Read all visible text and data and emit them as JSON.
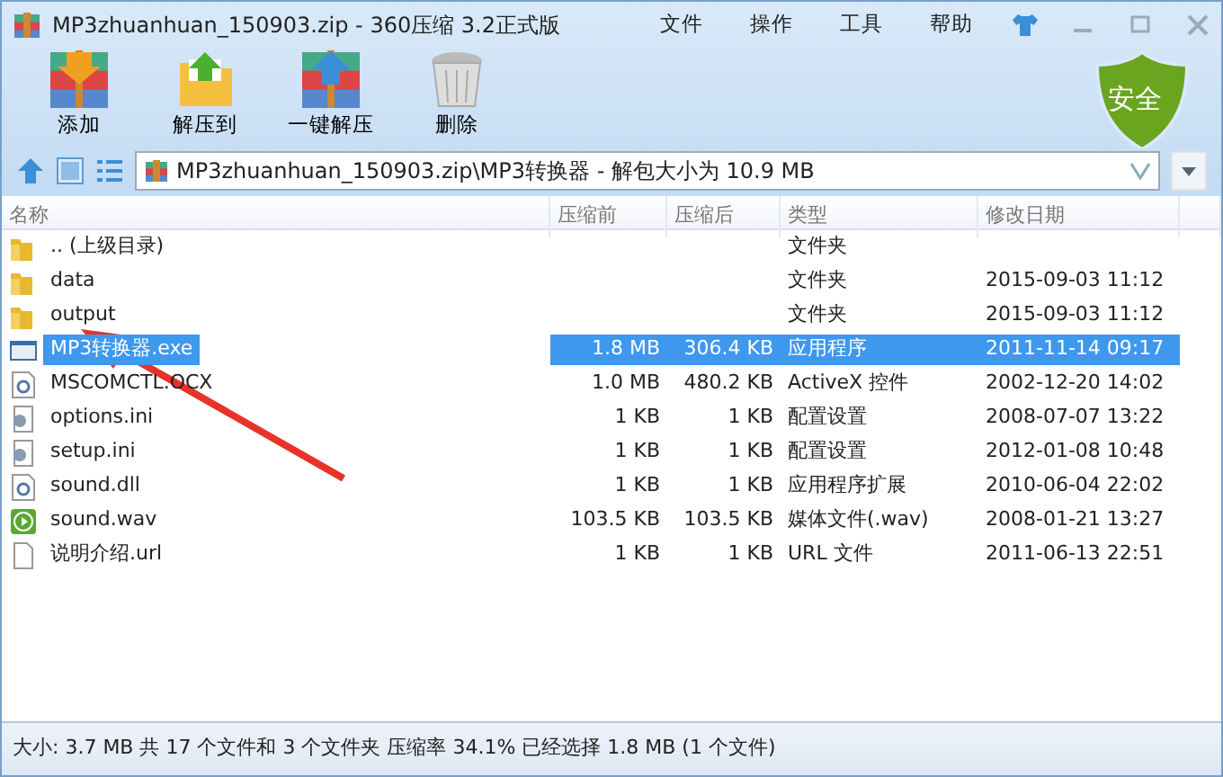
{
  "window": {
    "title": "MP3zhuanhuan_150903.zip - 360压缩 3.2正式版"
  },
  "menu": [
    "文件",
    "操作",
    "工具",
    "帮助"
  ],
  "toolbar": [
    {
      "label": "添加",
      "kind": "add"
    },
    {
      "label": "解压到",
      "kind": "extract-to"
    },
    {
      "label": "一键解压",
      "kind": "extract"
    },
    {
      "label": "删除",
      "kind": "delete"
    }
  ],
  "security_badge": "安全",
  "address": {
    "value": "MP3zhuanhuan_150903.zip\\MP3转换器 - 解包大小为 10.9 MB"
  },
  "table": {
    "columns": [
      "名称",
      "压缩前",
      "压缩后",
      "类型",
      "修改日期"
    ],
    "rows": [
      {
        "kind": "folder",
        "name": ".. (上级目录)",
        "size": "",
        "packed": "",
        "type": "文件夹",
        "modified": "",
        "selected": false
      },
      {
        "kind": "folder",
        "name": "data",
        "size": "",
        "packed": "",
        "type": "文件夹",
        "modified": "2015-09-03 11:12",
        "selected": false
      },
      {
        "kind": "folder",
        "name": "output",
        "size": "",
        "packed": "",
        "type": "文件夹",
        "modified": "2015-09-03 11:12",
        "selected": false
      },
      {
        "kind": "exe",
        "name": "MP3转换器.exe",
        "size": "1.8 MB",
        "packed": "306.4 KB",
        "type": "应用程序",
        "modified": "2011-11-14 09:17",
        "selected": true
      },
      {
        "kind": "ocx",
        "name": "MSCOMCTL.OCX",
        "size": "1.0 MB",
        "packed": "480.2 KB",
        "type": "ActiveX 控件",
        "modified": "2002-12-20 14:02",
        "selected": false
      },
      {
        "kind": "ini",
        "name": "options.ini",
        "size": "1 KB",
        "packed": "1 KB",
        "type": "配置设置",
        "modified": "2008-07-07 13:22",
        "selected": false
      },
      {
        "kind": "ini",
        "name": "setup.ini",
        "size": "1 KB",
        "packed": "1 KB",
        "type": "配置设置",
        "modified": "2012-01-08 10:48",
        "selected": false
      },
      {
        "kind": "ocx",
        "name": "sound.dll",
        "size": "1 KB",
        "packed": "1 KB",
        "type": "应用程序扩展",
        "modified": "2010-06-04 22:02",
        "selected": false
      },
      {
        "kind": "wav",
        "name": "sound.wav",
        "size": "103.5 KB",
        "packed": "103.5 KB",
        "type": "媒体文件(.wav)",
        "modified": "2008-01-21 13:27",
        "selected": false
      },
      {
        "kind": "url",
        "name": "说明介绍.url",
        "size": "1 KB",
        "packed": "1 KB",
        "type": "URL 文件",
        "modified": "2011-06-13 22:51",
        "selected": false
      }
    ]
  },
  "status_bar": "大小: 3.7 MB 共 17 个文件和 3 个文件夹 压缩率 34.1% 已经选择 1.8 MB (1 个文件)"
}
